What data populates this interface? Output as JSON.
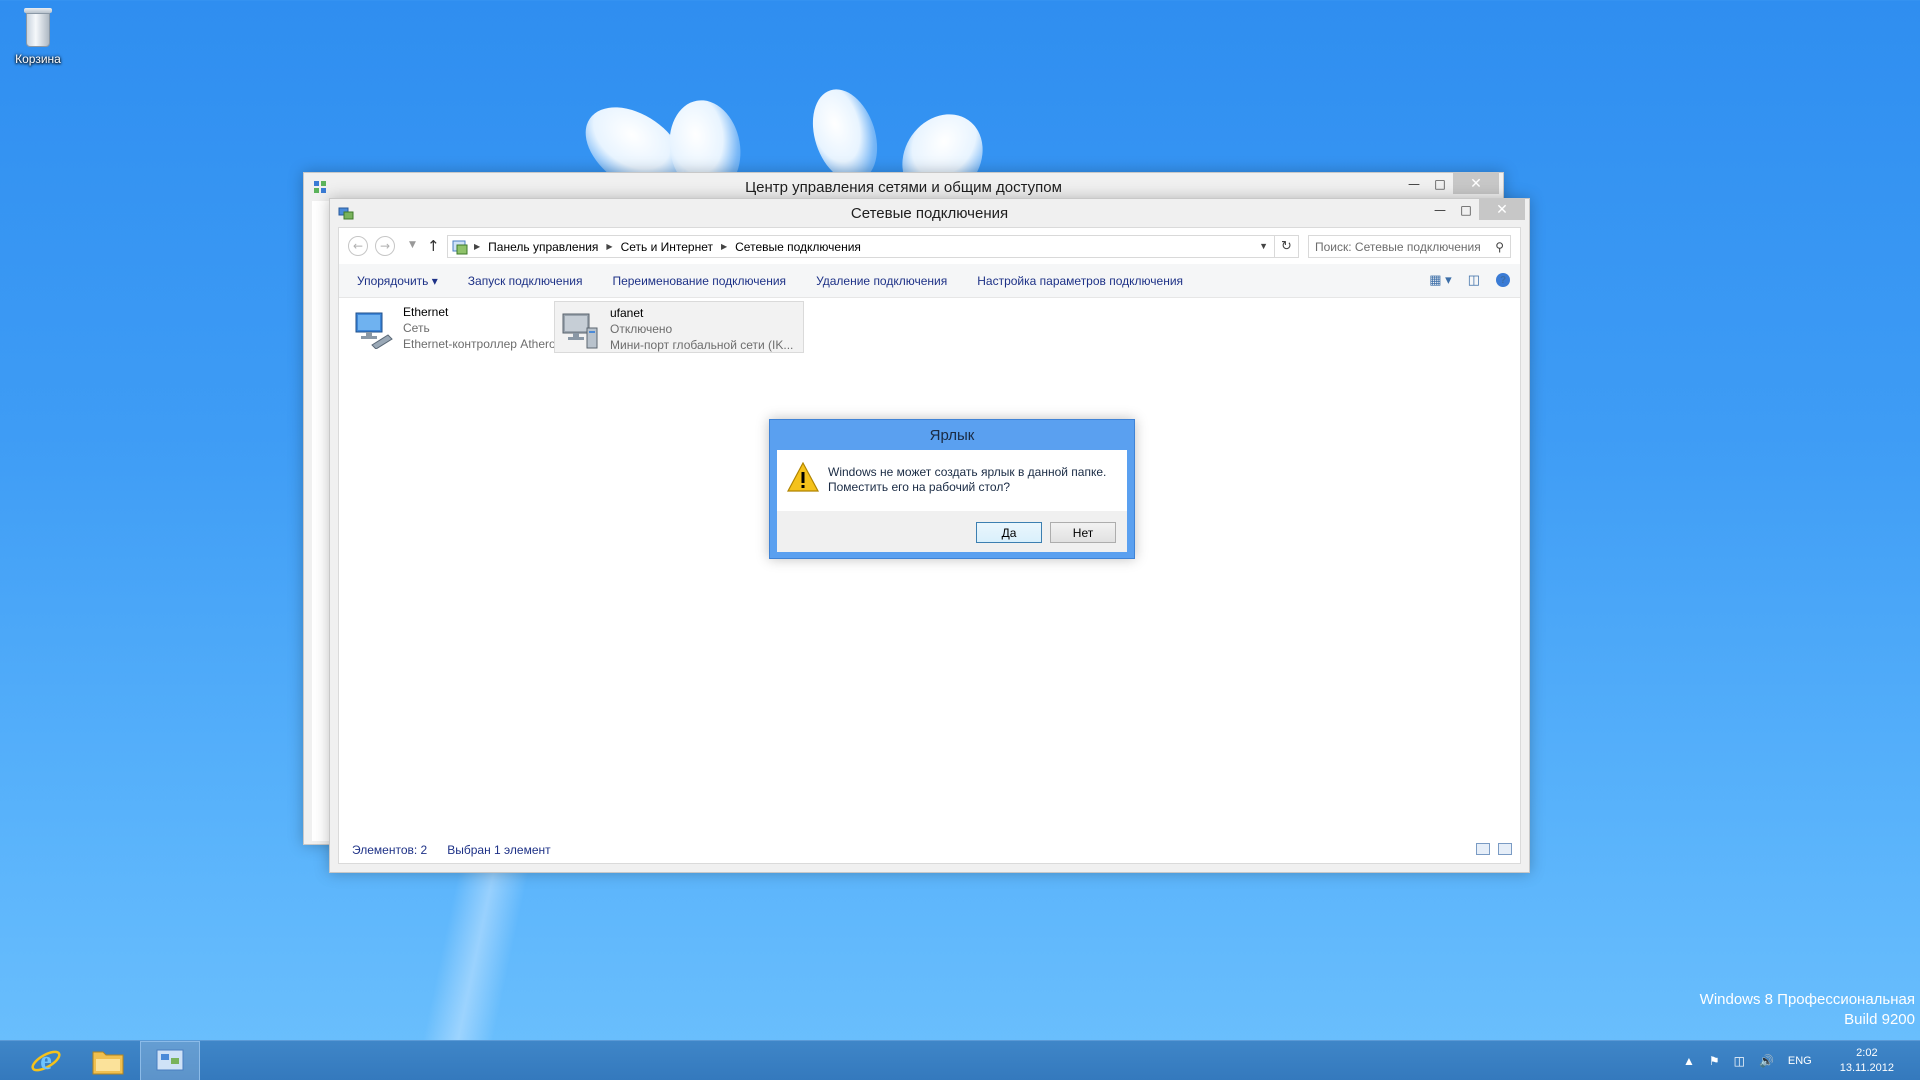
{
  "desktop": {
    "recycle_bin_label": "Корзина",
    "watermark_line1": "Windows 8 Профессиональная",
    "watermark_line2": "Build 9200"
  },
  "back_window": {
    "title": "Центр управления сетями и общим доступом"
  },
  "front_window": {
    "title": "Сетевые подключения",
    "breadcrumb": [
      "Панель управления",
      "Сеть и Интернет",
      "Сетевые подключения"
    ],
    "search_placeholder": "Поиск: Сетевые подключения",
    "commands": {
      "organize": "Упорядочить",
      "start": "Запуск подключения",
      "rename": "Переименование подключения",
      "delete": "Удаление подключения",
      "settings": "Настройка параметров подключения"
    },
    "items": [
      {
        "name": "Ethernet",
        "status": "Сеть",
        "device": "Ethernet-контроллер Atheros AR...",
        "icon": "ethernet-adapter-icon",
        "selected": false
      },
      {
        "name": "ufanet",
        "status": "Отключено",
        "device": "Мини-порт глобальной сети (IK...",
        "icon": "wan-miniport-icon",
        "selected": true
      }
    ],
    "status_count": "Элементов: 2",
    "status_selected": "Выбран 1 элемент"
  },
  "dialog": {
    "title": "Ярлык",
    "message_line1": "Windows не может создать ярлык в данной папке.",
    "message_line2": "Поместить его на рабочий стол?",
    "yes_label": "Да",
    "no_label": "Нет"
  },
  "taskbar": {
    "language": "ENG",
    "time": "2:02",
    "date": "13.11.2012"
  },
  "colors": {
    "accent": "#5aa0f0",
    "link": "#1e3287"
  }
}
